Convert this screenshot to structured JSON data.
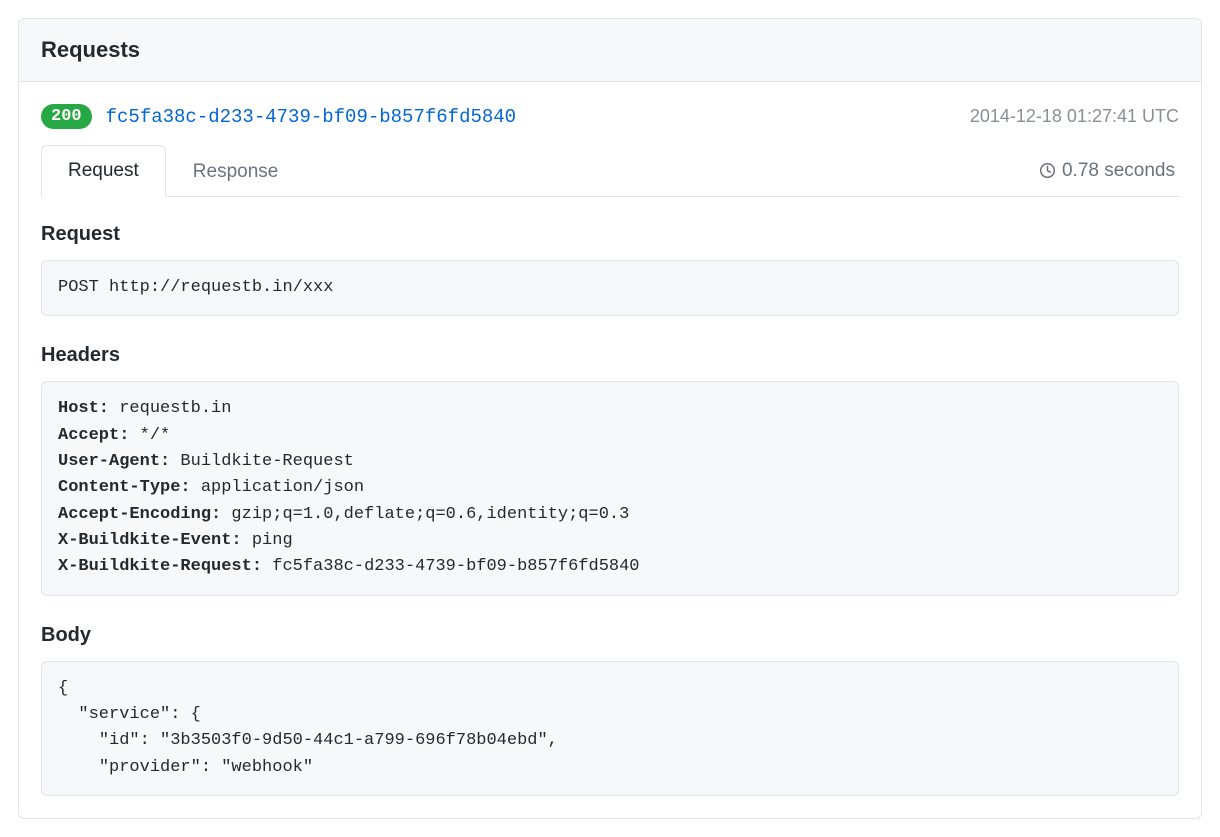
{
  "title": "Requests",
  "request": {
    "status": "200",
    "uuid": "fc5fa38c-d233-4739-bf09-b857f6fd5840",
    "timestamp": "2014-12-18 01:27:41 UTC",
    "duration": "0.78 seconds"
  },
  "tabs": {
    "request": "Request",
    "response": "Response"
  },
  "sections": {
    "request_heading": "Request",
    "headers_heading": "Headers",
    "body_heading": "Body",
    "request_line": {
      "method": "POST",
      "url": "http://requestb.in/xxx"
    },
    "headers": [
      {
        "k": "Host:",
        "v": "requestb.in"
      },
      {
        "k": "Accept:",
        "v": "*/*"
      },
      {
        "k": "User-Agent:",
        "v": "Buildkite-Request"
      },
      {
        "k": "Content-Type:",
        "v": "application/json"
      },
      {
        "k": "Accept-Encoding:",
        "v": "gzip;q=1.0,deflate;q=0.6,identity;q=0.3"
      },
      {
        "k": "X-Buildkite-Event:",
        "v": "ping"
      },
      {
        "k": "X-Buildkite-Request:",
        "v": "fc5fa38c-d233-4739-bf09-b857f6fd5840"
      }
    ],
    "body": "{\n  \"service\": {\n    \"id\": \"3b3503f0-9d50-44c1-a799-696f78b04ebd\",\n    \"provider\": \"webhook\""
  }
}
